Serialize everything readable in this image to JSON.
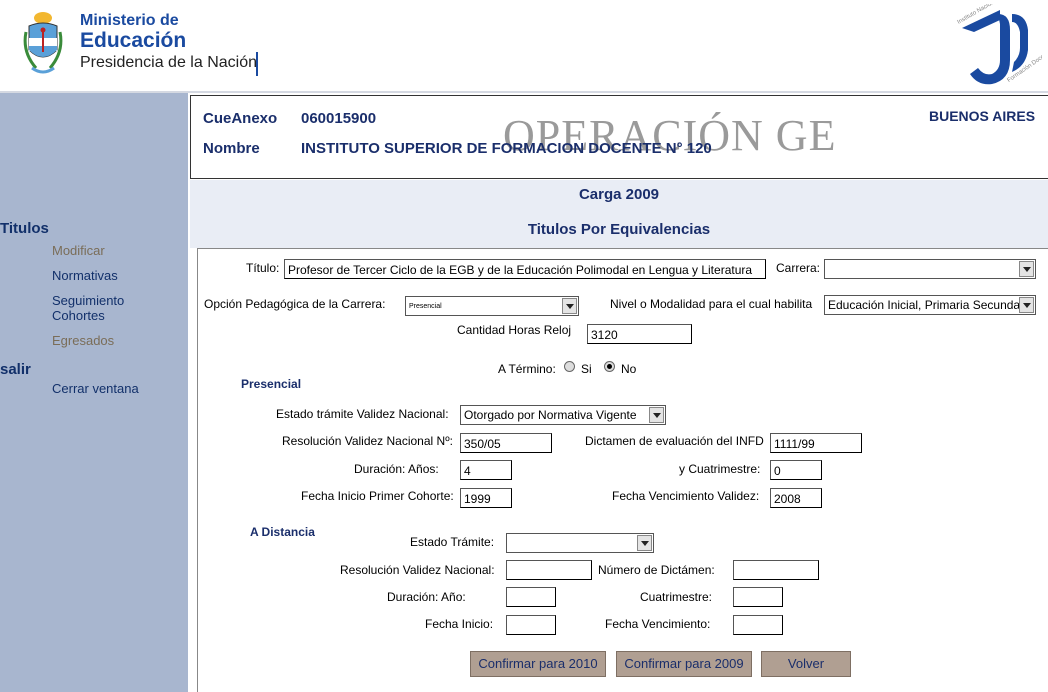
{
  "header": {
    "ministerio": "Ministerio de",
    "educacion": "Educación",
    "presidencia": "Presidencia de la Nación"
  },
  "sidebar": {
    "section_titulos": "Titulos",
    "items": [
      {
        "label": "Modificar",
        "enabled": false
      },
      {
        "label": "Normativas",
        "enabled": true
      },
      {
        "label": "Seguimiento Cohortes",
        "enabled": true
      },
      {
        "label": "Egresados",
        "enabled": false
      }
    ],
    "section_salir": "salir",
    "cerrar": "Cerrar ventana"
  },
  "info": {
    "cueanexo_label": "CueAnexo",
    "cueanexo_value": "060015900",
    "nombre_label": "Nombre",
    "nombre_value": "INSTITUTO SUPERIOR DE FORMACION DOCENTE N° 120",
    "provincia": "BUENOS AIRES",
    "watermark": "OPERACIÓN GE"
  },
  "page": {
    "carga": "Carga 2009",
    "subtitle": "Titulos Por Equivalencias"
  },
  "form": {
    "titulo_label": "Título:",
    "titulo_value": "Profesor de Tercer Ciclo de la EGB y de la Educación Polimodal en Lengua y Literatura",
    "carrera_label": "Carrera:",
    "carrera_value": "",
    "opcion_label": "Opción Pedagógica de la Carrera:",
    "opcion_value": "Presencial",
    "nivel_label": "Nivel o Modalidad para el cual habilita",
    "nivel_value": "Educación Inicial, Primaria Secundaria",
    "horas_label": "Cantidad Horas Reloj",
    "horas_value": "3120",
    "termino_label": "A Término:",
    "termino_si": "Si",
    "termino_no": "No",
    "termino_selected": "No",
    "presencial": {
      "section": "Presencial",
      "estado_label": "Estado trámite Validez Nacional:",
      "estado_value": "Otorgado por Normativa Vigente",
      "resolucion_label": "Resolución Validez Nacional Nº:",
      "resolucion_value": "350/05",
      "dictamen_label": "Dictamen de evaluación del INFD",
      "dictamen_value": "1111/99",
      "duracion_label": "Duración:  Años:",
      "duracion_value": "4",
      "cuatrimestre_label": "y Cuatrimestre:",
      "cuatrimestre_value": "0",
      "fecha_inicio_label": "Fecha Inicio Primer Cohorte:",
      "fecha_inicio_value": "1999",
      "fecha_venc_label": "Fecha Vencimiento Validez:",
      "fecha_venc_value": "2008"
    },
    "distancia": {
      "section": "A Distancia",
      "estado_label": "Estado Trámite:",
      "estado_value": "",
      "resolucion_label": "Resolución Validez Nacional:",
      "resolucion_value": "",
      "dictamen_label": "Número de Dictámen:",
      "dictamen_value": "",
      "duracion_label": "Duración:   Año:",
      "duracion_value": "",
      "cuatrimestre_label": "Cuatrimestre:",
      "cuatrimestre_value": "",
      "fecha_inicio_label": "Fecha Inicio:",
      "fecha_inicio_value": "",
      "fecha_venc_label": "Fecha Vencimiento:",
      "fecha_venc_value": ""
    }
  },
  "buttons": {
    "confirmar_2010": "Confirmar para 2010",
    "confirmar_2009": "Confirmar para 2009",
    "volver": "Volver"
  },
  "colors": {
    "sidebar_bg": "#a8b6cf",
    "title_blue": "#1a2e6b",
    "brand_blue": "#1a4aa0",
    "button_bg": "#b09f92",
    "title_area_bg": "#e9edf5"
  }
}
